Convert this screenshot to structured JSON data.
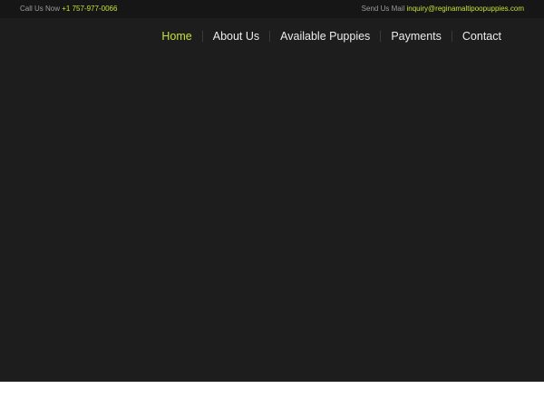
{
  "topbar": {
    "call_label": "Call Us Now",
    "phone": "+1 757-977-0066",
    "mail_label": "Send Us Mail",
    "email": "inquiry@reginamaltipoopuppies.com"
  },
  "nav": {
    "items": [
      {
        "label": "Home",
        "active": true
      },
      {
        "label": "About Us",
        "active": false
      },
      {
        "label": "Available Puppies",
        "active": false
      },
      {
        "label": "Payments",
        "active": false
      },
      {
        "label": "Contact",
        "active": false
      }
    ]
  },
  "colors": {
    "accent": "#c6e037",
    "topbar_bg": "#161616",
    "header_bg": "#1d1d1d",
    "text": "#ececec"
  }
}
